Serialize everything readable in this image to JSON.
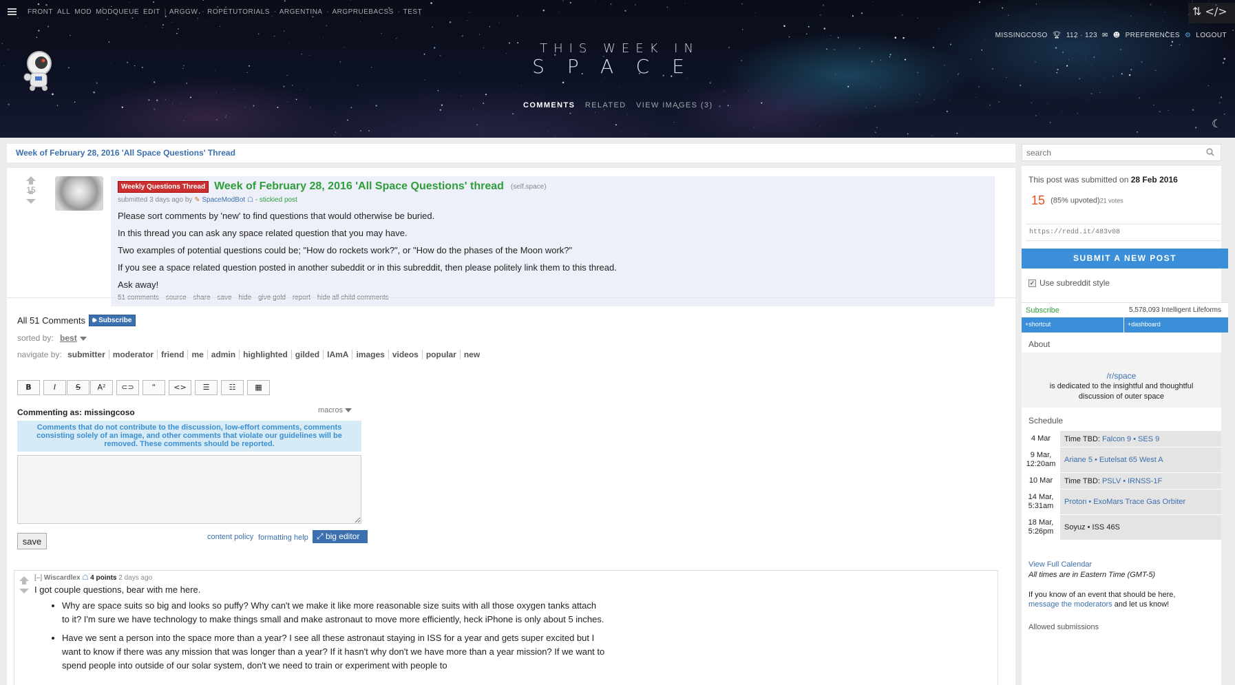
{
  "header": {
    "sr_links": [
      "FRONT",
      "ALL",
      "MOD",
      "MODQUEUE",
      "EDIT",
      "ARGGW",
      "ROPETUTORIALS",
      "ARGENTINA",
      "ARGPRUEBACSS",
      "TEST"
    ],
    "title_line1": "THIS WEEK IN",
    "title_line2": "SPACE",
    "tabs": [
      "COMMENTS",
      "RELATED",
      "VIEW IMAGES (3)"
    ],
    "username": "MISSINGCOSO",
    "karma": "112 · 123",
    "preferences": "PREFERENCES",
    "logout": "LOGOUT",
    "corner_icons": "⇅ </>"
  },
  "breadcrumb": "Week of February 28, 2016 'All Space Questions' Thread",
  "post": {
    "score": "15",
    "flair": "Weekly Questions Thread",
    "title": "Week of February 28, 2016 'All Space Questions' thread",
    "domain": "(self.space)",
    "submitted": "submitted 3 days ago by",
    "author": "SpaceModBot",
    "stickied": "- stickied post",
    "paragraphs": [
      "Please sort comments by 'new' to find questions that would otherwise be buried.",
      "In this thread you can ask any space related question that you may have.",
      "Two examples of potential questions could be; \"How do rockets work?\", or \"How do the phases of the Moon work?\"",
      "If you see a space related question posted in another subeddit or in this subreddit, then please politely link them to this thread.",
      "Ask away!"
    ],
    "buttons": [
      "51 comments",
      "source",
      "share",
      "save",
      "hide",
      "give gold",
      "report",
      "hide all child comments"
    ]
  },
  "comments_area": {
    "all_comments": "All 51 Comments",
    "subscribe": "Subscribe",
    "sorted_label": "sorted by:",
    "sorted_value": "best",
    "navigate_label": "navigate by:",
    "navigate_items": [
      "submitter",
      "moderator",
      "friend",
      "me",
      "admin",
      "highlighted",
      "gilded",
      "IAmA",
      "images",
      "videos",
      "popular",
      "new"
    ],
    "toolbar": [
      "B",
      "I",
      "S",
      "A²",
      "⊂⊃",
      "“",
      "<>",
      "☰",
      "☷",
      "▦"
    ],
    "commenting_as": "Commenting as: missingcoso",
    "macros": "macros",
    "guidelines": "Comments that do not contribute to the discussion, low-effort comments, comments consisting solely of an image, and other comments that violate our guidelines will be removed. These comments should be reported.",
    "save": "save",
    "content_policy": "content policy",
    "formatting_help": "formatting help",
    "big_editor": "big editor"
  },
  "comment": {
    "collapse": "[–]",
    "author": "Wiscardlex",
    "points": "4 points",
    "time": "2 days ago",
    "intro": "I got couple questions, bear with me here.",
    "bullets": [
      "Why are space suits so big and looks so puffy? Why can't we make it like more reasonable size suits with all those oxygen tanks attach to it? I'm sure we have technology to make things small and make astronaut to move more efficiently, heck iPhone is only about 5 inches.",
      "Have we sent a person into the space more than a year? I see all these astronaut staying in ISS for a year and gets super excited but I want to know if there was any mission that was longer than a year? If it hasn't why don't we have more than a year mission? If we want to spend people into outside of our solar system, don't we need to train or experiment with people to"
    ]
  },
  "sidebar": {
    "search_placeholder": "search",
    "submitted_on": "This post was submitted on",
    "submitted_date": "28 Feb 2016",
    "score": "15",
    "upvoted": "(85% upvoted)",
    "votes": "21 votes",
    "shortlink": "https://redd.it/483v08",
    "submit_post": "SUBMIT A NEW POST",
    "use_style": "Use subreddit style",
    "subscribe": "Subscribe",
    "subscribers": "5,578,093 Intelligent Lifeforms",
    "shortcut": "+shortcut",
    "dashboard": "+dashboard",
    "about": "About",
    "sr_name": "/r/space",
    "sr_desc": "is dedicated to the insightful and thoughtful discussion of outer space",
    "schedule_heading": "Schedule",
    "schedule": [
      {
        "date": "4 Mar",
        "prefix": "Time TBD:",
        "links": [
          "Falcon 9",
          "SES 9"
        ]
      },
      {
        "date": "9 Mar, 12:20am",
        "prefix": "",
        "links": [
          "Ariane 5",
          "Eutelsat 65 West A"
        ]
      },
      {
        "date": "10 Mar",
        "prefix": "Time TBD:",
        "links": [
          "PSLV",
          "IRNSS-1F"
        ]
      },
      {
        "date": "14 Mar, 5:31am",
        "prefix": "",
        "links": [
          "Proton",
          "ExoMars Trace Gas Orbiter"
        ]
      },
      {
        "date": "18 Mar, 5:26pm",
        "prefix": "",
        "links": [],
        "plain": "Soyuz • ISS 46S"
      }
    ],
    "calendar_link": "View Full Calendar",
    "tz_note": "All times are in Eastern Time (GMT-5)",
    "event_note_pre": "If you know of an event that should be here,",
    "event_note_link": "message the moderators",
    "event_note_post": "and let us know!",
    "allowed": "Allowed submissions"
  }
}
